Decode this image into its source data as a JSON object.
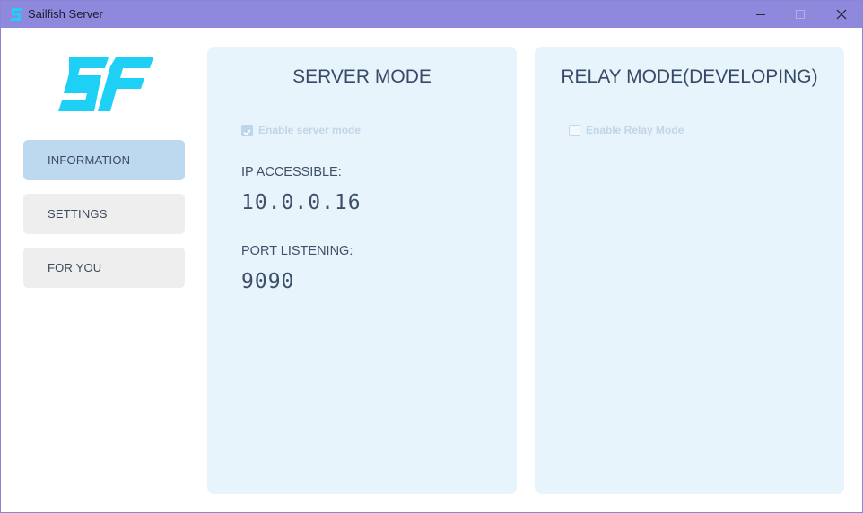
{
  "window": {
    "title": "Sailfish Server",
    "icon": "sailfish-app-icon",
    "controls": [
      "minimize-icon",
      "maximize-icon",
      "close-icon"
    ]
  },
  "logo": {
    "text": "SF",
    "color": "#1ed0f5"
  },
  "sidebar": {
    "items": [
      {
        "label": "INFORMATION",
        "active": true
      },
      {
        "label": "SETTINGS",
        "active": false
      },
      {
        "label": "FOR YOU",
        "active": false
      }
    ]
  },
  "server_panel": {
    "title": "SERVER MODE",
    "enable_label": "Enable server mode",
    "enable_checked": true,
    "ip_label": "IP ACCESSIBLE:",
    "ip_value": "10.0.0.16",
    "port_label": "PORT LISTENING:",
    "port_value": "9090"
  },
  "relay_panel": {
    "title": "RELAY MODE(DEVELOPING)",
    "enable_label": "Enable Relay Mode",
    "enable_checked": false
  },
  "colors": {
    "titlebar": "#8e89dd",
    "accent": "#1ed0f5",
    "active_nav": "#bcd9f0",
    "panel_bg": "#e8f4fc"
  }
}
